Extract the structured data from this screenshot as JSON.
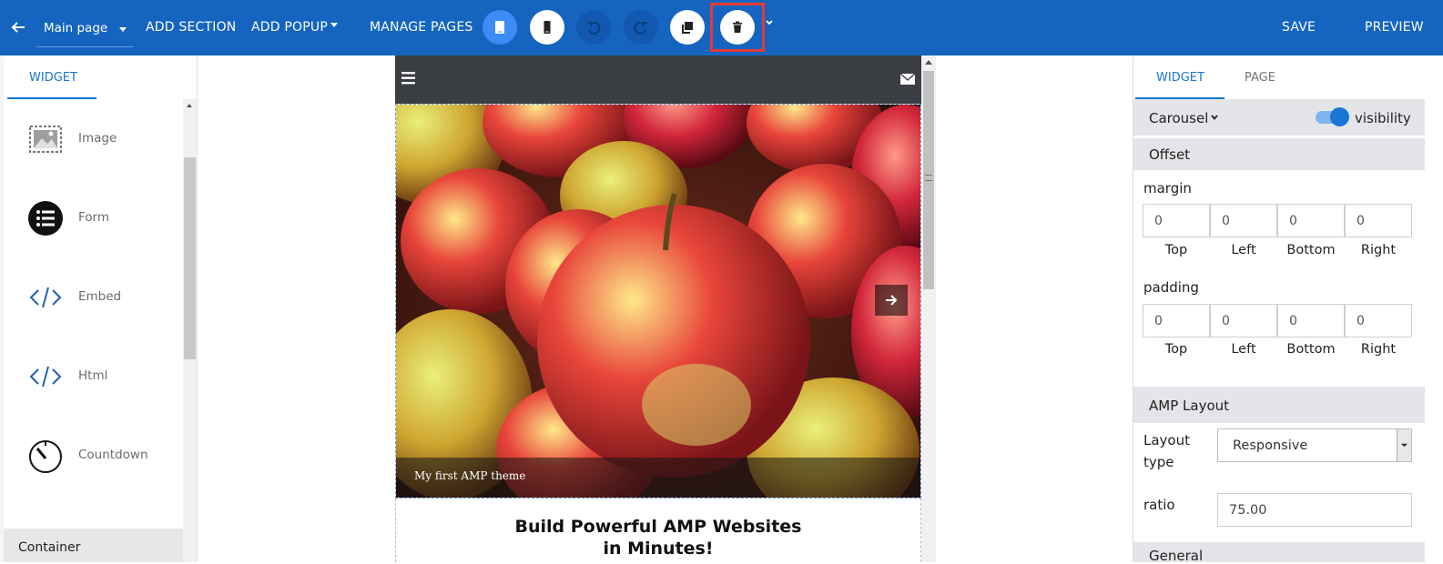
{
  "topbar": {
    "page_select": "Main page",
    "add_section": "ADD SECTION",
    "add_popup": "ADD POPUP",
    "manage_pages": "MANAGE PAGES",
    "save": "SAVE",
    "preview": "PREVIEW",
    "colors": {
      "bar": "#1565c0",
      "highlight": "#e53935"
    }
  },
  "left_panel": {
    "tab": "WIDGET",
    "widgets": [
      {
        "label": "Image",
        "icon": "image-icon"
      },
      {
        "label": "Form",
        "icon": "form-list-icon"
      },
      {
        "label": "Embed",
        "icon": "code-icon"
      },
      {
        "label": "Html",
        "icon": "code-icon"
      },
      {
        "label": "Countdown",
        "icon": "timer-icon"
      }
    ],
    "container_label": "Container"
  },
  "preview": {
    "caption": "My first AMP theme",
    "headline_line1": "Build Powerful AMP Websites",
    "headline_line2": "in Minutes!"
  },
  "right_panel": {
    "tabs": [
      "WIDGET",
      "PAGE"
    ],
    "widget_type": "Carousel",
    "visibility_label": "visibility",
    "offset_header": "Offset",
    "margin_label": "margin",
    "margin_values": [
      "0",
      "0",
      "0",
      "0"
    ],
    "padding_label": "padding",
    "padding_values": [
      "0",
      "0",
      "0",
      "0"
    ],
    "side_labels": [
      "Top",
      "Left",
      "Bottom",
      "Right"
    ],
    "amp_layout_header": "AMP Layout",
    "layout_type_label_1": "Layout",
    "layout_type_label_2": "type",
    "layout_type_value": "Responsive",
    "ratio_label": "ratio",
    "ratio_value": "75.00",
    "next_section": "General"
  }
}
